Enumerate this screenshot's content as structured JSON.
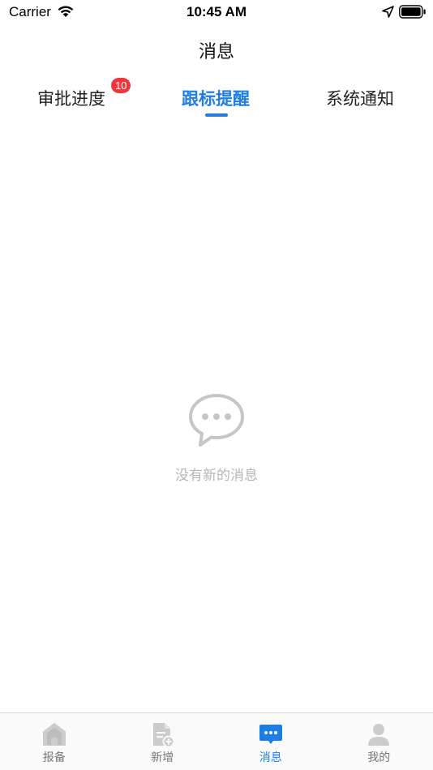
{
  "status_bar": {
    "carrier": "Carrier",
    "time": "10:45 AM",
    "icons": [
      "wifi-icon",
      "location-arrow-icon",
      "battery-icon"
    ]
  },
  "header": {
    "title": "消息"
  },
  "tabs": [
    {
      "label": "审批进度",
      "badge": "10",
      "active": false
    },
    {
      "label": "跟标提醒",
      "active": true
    },
    {
      "label": "系统通知",
      "active": false
    }
  ],
  "empty_state": {
    "icon": "chat-bubble-icon",
    "text": "没有新的消息"
  },
  "tab_bar": [
    {
      "label": "报备",
      "icon": "home-icon",
      "active": false
    },
    {
      "label": "新增",
      "icon": "document-add-icon",
      "active": false
    },
    {
      "label": "消息",
      "icon": "message-icon",
      "active": true
    },
    {
      "label": "我的",
      "icon": "user-icon",
      "active": false
    }
  ],
  "colors": {
    "accent": "#1f7ee3",
    "badge": "#f0373e",
    "inactive_icon": "#cccccc",
    "empty_text": "#b5b5b5"
  }
}
